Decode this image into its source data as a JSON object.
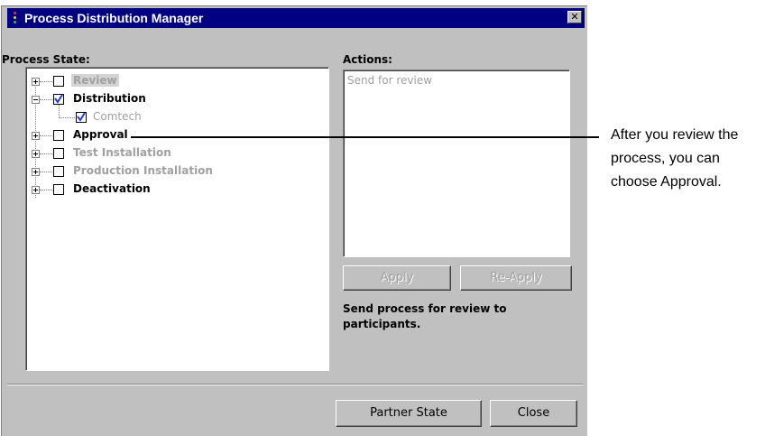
{
  "dialog": {
    "title": "Process Distribution Manager",
    "close_glyph": "✕",
    "title_bar_color": "#000080"
  },
  "process_state": {
    "label": "Process State:",
    "nodes": [
      {
        "label": "Review",
        "checked": false,
        "expanded": false,
        "bold": true,
        "gray": true,
        "highlighted": true
      },
      {
        "label": "Distribution",
        "checked": true,
        "expanded": true,
        "bold": true,
        "gray": false
      },
      {
        "label": "Comtech",
        "checked": true,
        "child": true,
        "bold": false,
        "gray": true
      },
      {
        "label": "Approval",
        "checked": false,
        "expanded": false,
        "bold": true,
        "gray": false
      },
      {
        "label": "Test Installation",
        "checked": false,
        "expanded": false,
        "bold": true,
        "gray": true
      },
      {
        "label": "Production Installation",
        "checked": false,
        "expanded": false,
        "bold": true,
        "gray": true
      },
      {
        "label": "Deactivation",
        "checked": false,
        "expanded": false,
        "bold": true,
        "gray": false
      }
    ]
  },
  "actions": {
    "label": "Actions:",
    "items": [
      "Send for review"
    ],
    "apply_label": "Apply",
    "reapply_label": "Re-Apply",
    "description": "Send process for review to participants."
  },
  "footer": {
    "partner_state_label": "Partner State",
    "close_label": "Close"
  },
  "callout": {
    "text": "After you review the\nprocess, you can\nchoose Approval."
  },
  "icons": {
    "expand": "plus-box-icon",
    "collapse": "minus-box-icon",
    "check": "checkmark-icon",
    "app": "traffic-light-icon",
    "close": "close-icon"
  }
}
